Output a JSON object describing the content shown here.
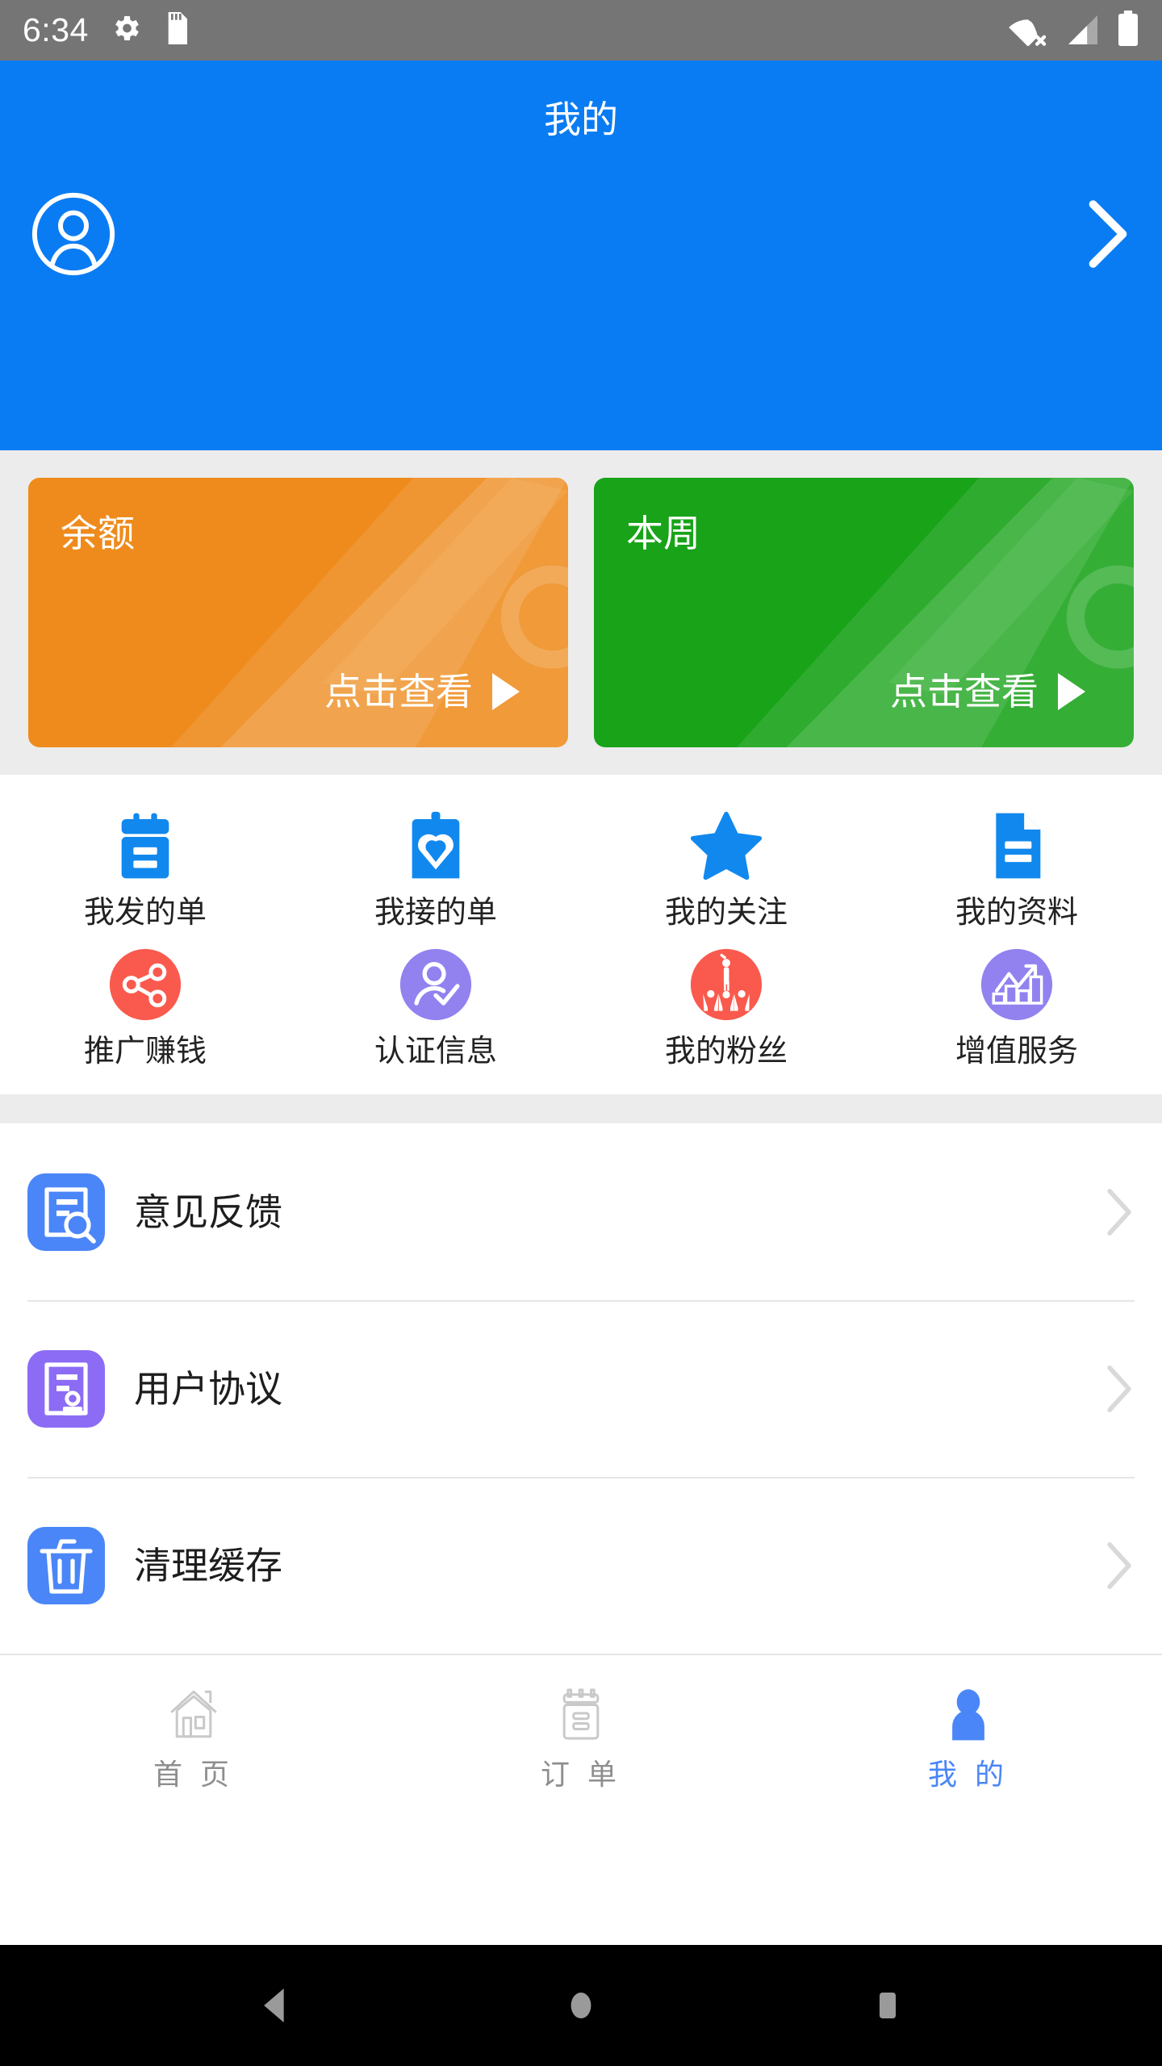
{
  "statusbar": {
    "time": "6:34",
    "left_icons": [
      "gear-icon",
      "sd-card-icon"
    ],
    "right_icons": [
      "wifi-off-icon",
      "cellular-signal-icon",
      "battery-icon"
    ]
  },
  "header": {
    "title": "我的",
    "avatar_icon": "user-avatar-icon",
    "chevron_icon": "chevron-right-icon",
    "background_color": "#0a7cf3"
  },
  "cards": [
    {
      "title": "余额",
      "cta": "点击查看",
      "color": "#ee8b1c",
      "arrow_icon": "play-triangle-icon"
    },
    {
      "title": "本周",
      "cta": "点击查看",
      "color": "#18a318",
      "arrow_icon": "play-triangle-icon"
    }
  ],
  "grid": {
    "rows": [
      [
        {
          "label": "我发的单",
          "icon": "clipboard-lines-icon",
          "color": "#1188ee"
        },
        {
          "label": "我接的单",
          "icon": "clipboard-heart-icon",
          "color": "#1188ee"
        },
        {
          "label": "我的关注",
          "icon": "star-icon",
          "color": "#1188ee"
        },
        {
          "label": "我的资料",
          "icon": "document-lines-icon",
          "color": "#1188ee"
        }
      ],
      [
        {
          "label": "推广赚钱",
          "icon": "share-nodes-icon",
          "color": "#f95a4d"
        },
        {
          "label": "认证信息",
          "icon": "user-check-icon",
          "color": "#9182f0"
        },
        {
          "label": "我的粉丝",
          "icon": "crowd-cheer-icon",
          "color": "#f95a4d"
        },
        {
          "label": "增值服务",
          "icon": "growth-chart-icon",
          "color": "#9182f0"
        }
      ]
    ]
  },
  "list": [
    {
      "label": "意见反馈",
      "icon": "feedback-doc-icon",
      "color": "#4a86f7",
      "chevron_icon": "chevron-right-icon"
    },
    {
      "label": "用户协议",
      "icon": "agreement-doc-icon",
      "color": "#8c6cf5",
      "chevron_icon": "chevron-right-icon"
    },
    {
      "label": "清理缓存",
      "icon": "trash-icon",
      "color": "#4a86f7",
      "chevron_icon": "chevron-right-icon"
    }
  ],
  "tabbar": {
    "items": [
      {
        "label": "首 页",
        "icon": "home-icon",
        "active": false
      },
      {
        "label": "订 单",
        "icon": "order-clipboard-icon",
        "active": false
      },
      {
        "label": "我 的",
        "icon": "person-icon",
        "active": true
      }
    ],
    "active_color": "#4a86f7",
    "inactive_color": "#8e8e8e"
  },
  "navbar": {
    "buttons": [
      "back-triangle-icon",
      "home-circle-icon",
      "recents-square-icon"
    ]
  }
}
